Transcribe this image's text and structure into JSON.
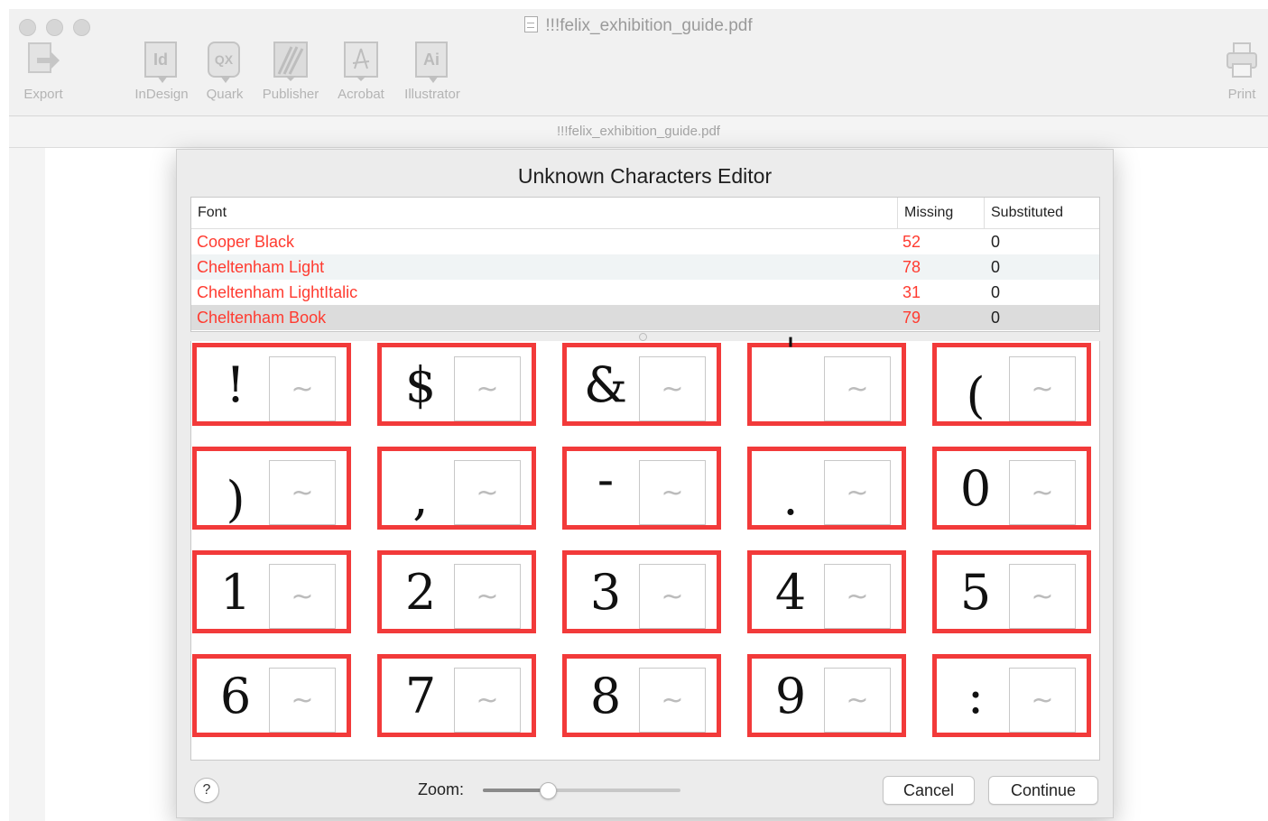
{
  "window": {
    "title": "!!!felix_exhibition_guide.pdf",
    "path": "!!!felix_exhibition_guide.pdf"
  },
  "toolbar": {
    "items": [
      {
        "label": "Export",
        "icon": "export-icon"
      },
      {
        "label": "InDesign",
        "icon": "indesign-icon",
        "glyph": "Id"
      },
      {
        "label": "Quark",
        "icon": "quark-icon",
        "glyph": "QX"
      },
      {
        "label": "Publisher",
        "icon": "publisher-icon",
        "glyph": ""
      },
      {
        "label": "Acrobat",
        "icon": "acrobat-icon",
        "glyph": ""
      },
      {
        "label": "Illustrator",
        "icon": "illustrator-icon",
        "glyph": "Ai"
      },
      {
        "label": "Print",
        "icon": "printer-icon"
      }
    ]
  },
  "dialog": {
    "title": "Unknown Characters Editor",
    "table": {
      "columns": [
        "Font",
        "Missing",
        "Substituted"
      ],
      "rows": [
        {
          "font": "Cooper Black",
          "missing": "52",
          "substituted": "0"
        },
        {
          "font": "Cheltenham Light",
          "missing": "78",
          "substituted": "0"
        },
        {
          "font": "Cheltenham LightItalic",
          "missing": "31",
          "substituted": "0"
        },
        {
          "font": "Cheltenham Book",
          "missing": "79",
          "substituted": "0",
          "selected": true
        }
      ]
    },
    "characters": [
      "!",
      "$",
      "&",
      "'",
      "(",
      ")",
      ",",
      "-",
      ".",
      "0",
      "1",
      "2",
      "3",
      "4",
      "5",
      "6",
      "7",
      "8",
      "9",
      ":"
    ],
    "substitute_placeholder": "~",
    "zoom_label": "Zoom:",
    "zoom_level": 0.33,
    "help_label": "?",
    "cancel_label": "Cancel",
    "continue_label": "Continue"
  },
  "colors": {
    "missing_font": "#ff3b30",
    "cell_border": "#f23a3a"
  }
}
